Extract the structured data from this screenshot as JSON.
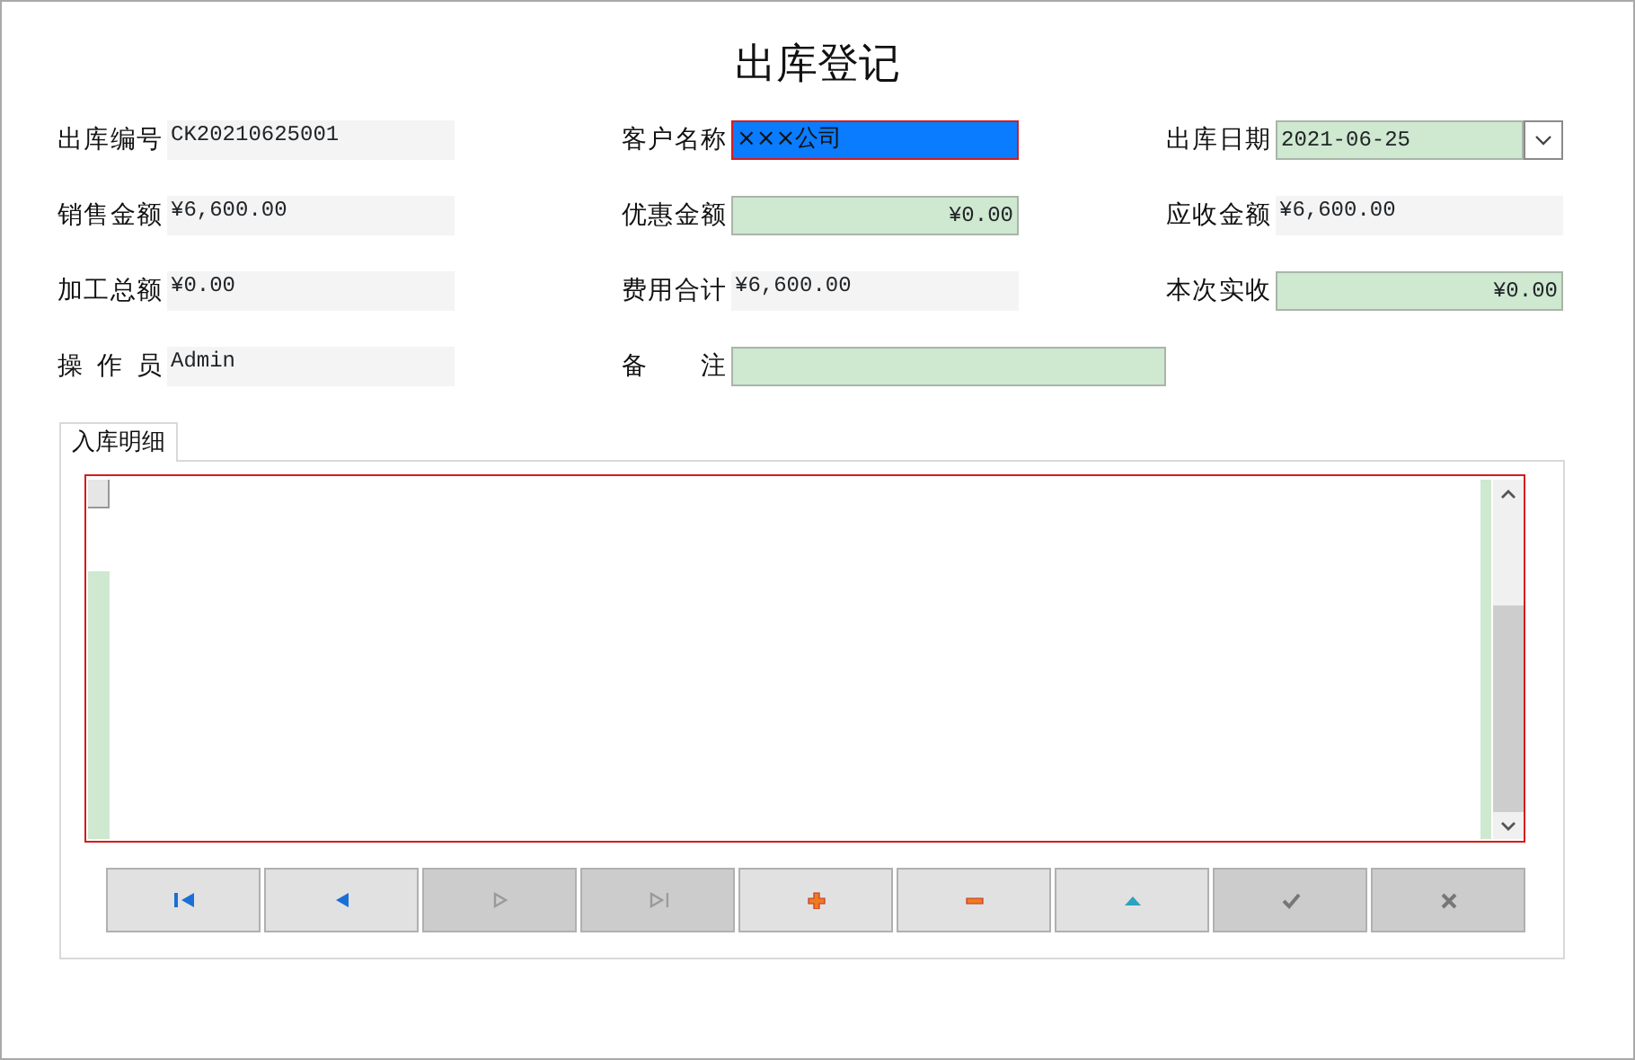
{
  "window": {
    "title": "出库登记"
  },
  "rows": [
    {
      "fields": [
        {
          "label": "出库编号",
          "value": "CK20210625001",
          "kind": "display"
        },
        {
          "label": "客户名称",
          "value": "×××公司",
          "kind": "focused"
        },
        {
          "label": "出库日期",
          "value": "2021-06-25",
          "kind": "date"
        }
      ]
    },
    {
      "fields": [
        {
          "label": "销售金额",
          "value": "¥6,600.00",
          "kind": "display"
        },
        {
          "label": "优惠金额",
          "value": "¥0.00",
          "kind": "input"
        },
        {
          "label": "应收金额",
          "value": "¥6,600.00",
          "kind": "display"
        }
      ]
    },
    {
      "fields": [
        {
          "label": "加工总额",
          "value": "¥0.00",
          "kind": "display"
        },
        {
          "label": "费用合计",
          "value": "¥6,600.00",
          "kind": "display"
        },
        {
          "label": "本次实收",
          "value": "¥0.00",
          "kind": "input"
        }
      ]
    },
    {
      "fields": [
        {
          "label": "操 作 员",
          "value": "Admin",
          "kind": "display"
        },
        {
          "label": "备 注",
          "kind": "wide"
        }
      ]
    }
  ],
  "tabs": [
    {
      "label": "入库明细",
      "selected": true
    }
  ],
  "buttons": [
    {
      "kind": "first",
      "disabled": false
    },
    {
      "kind": "prev",
      "disabled": false
    },
    {
      "kind": "next",
      "disabled": true
    },
    {
      "kind": "last",
      "disabled": true
    },
    {
      "kind": "add",
      "disabled": false
    },
    {
      "kind": "delete",
      "disabled": false
    },
    {
      "kind": "up",
      "disabled": false
    },
    {
      "kind": "confirm",
      "disabled": true
    },
    {
      "kind": "cancel",
      "disabled": true
    }
  ]
}
